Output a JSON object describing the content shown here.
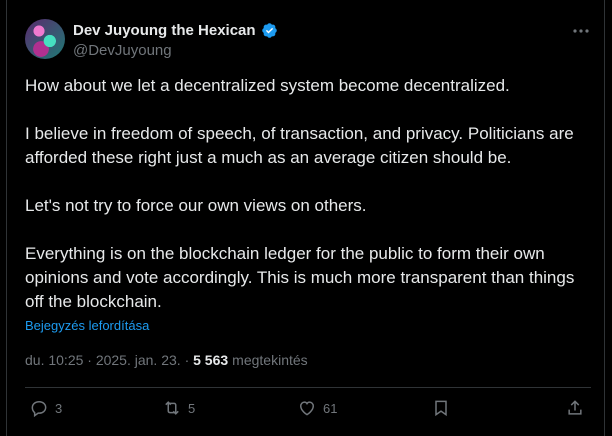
{
  "author": {
    "display_name": "Dev Juyoung the Hexican",
    "handle": "@DevJuyoung",
    "verified_icon": "verified-badge-icon",
    "accent_color": "#1d9bf0"
  },
  "tweet": {
    "paragraphs": [
      "How about we let a decentralized system become decentralized.",
      "I believe in freedom of speech, of transaction, and privacy. Politicians are afforded these right just a much as an average citizen should be.",
      "Let's not try to force our own views on others.",
      "Everything is on the blockchain ledger for the public to form their own opinions and vote accordingly. This is much more transparent than things off the blockchain."
    ],
    "translate_link": "Bejegyzés lefordítása",
    "timestamp": "du. 10:25 · 2025. jan. 23. · ",
    "views_count": "5 563",
    "views_label": "megtekintés"
  },
  "actions": {
    "replies": "3",
    "reposts": "5",
    "likes": "61"
  }
}
